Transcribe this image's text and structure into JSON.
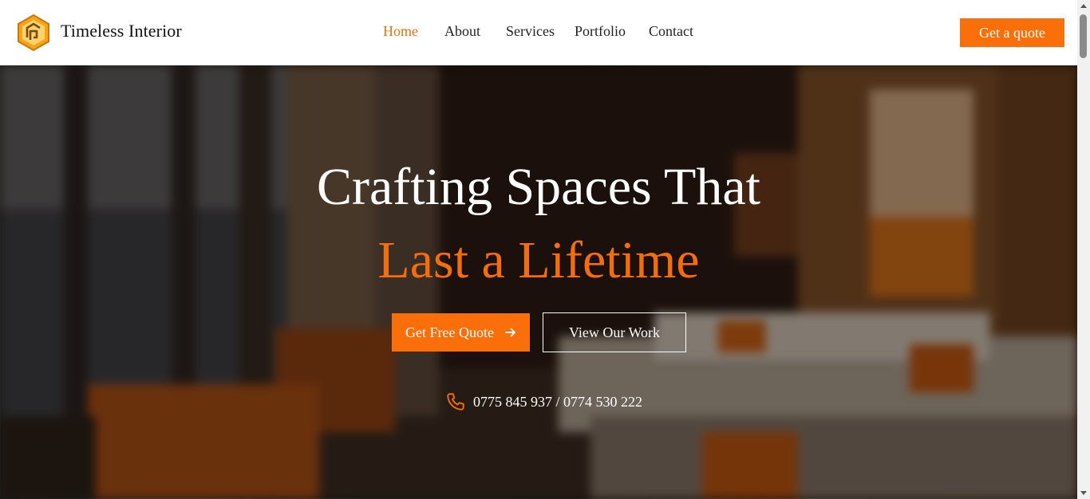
{
  "site": {
    "brand_name": "Timeless Interior",
    "logo_icon": "hexagon-logo-icon"
  },
  "nav": {
    "items": [
      {
        "label": "Home",
        "active": true
      },
      {
        "label": "About",
        "active": false
      },
      {
        "label": "Services",
        "active": false
      },
      {
        "label": "Portfolio",
        "active": false
      },
      {
        "label": "Contact",
        "active": false
      }
    ],
    "cta_label": "Get a quote"
  },
  "hero": {
    "headline_line1": "Crafting Spaces That",
    "headline_line2": "Last a Lifetime",
    "primary_button": "Get Free Quote",
    "primary_button_icon": "arrow-right-icon",
    "secondary_button": "View Our Work",
    "phone_icon": "phone-icon",
    "phone_numbers": "0775 845 937 / 0774 530 222"
  },
  "colors": {
    "accent": "#fb6f0a",
    "nav_active": "#f26e0f",
    "header_bg": "#ffffff",
    "text_light": "#ffffff"
  }
}
